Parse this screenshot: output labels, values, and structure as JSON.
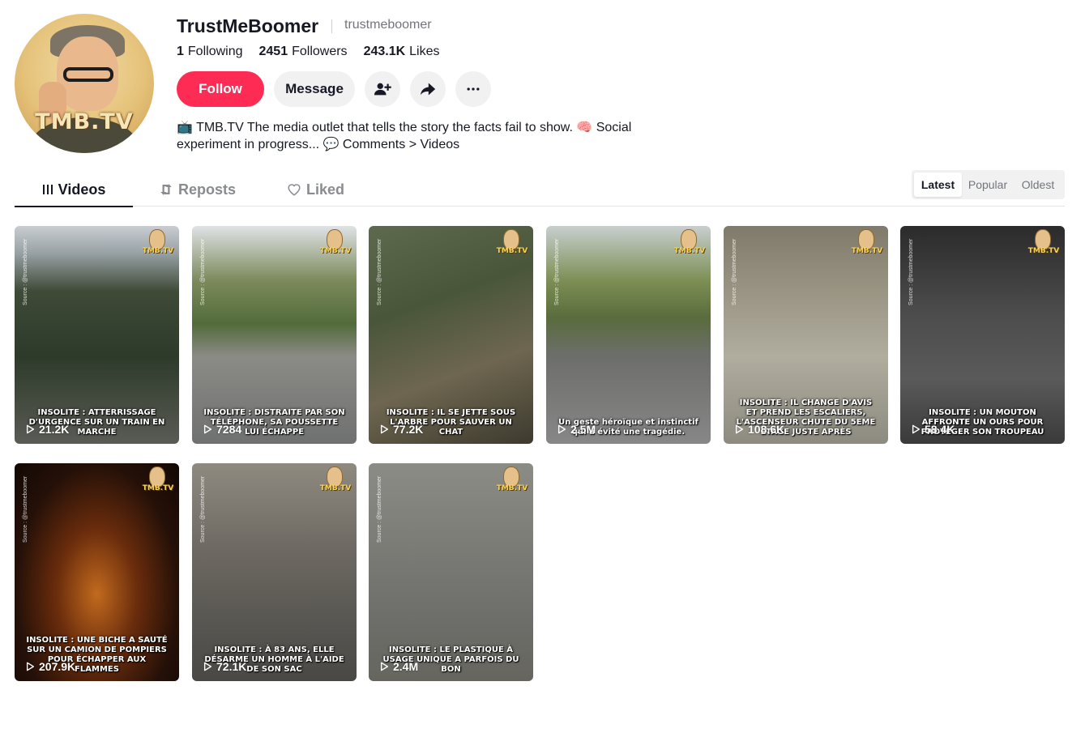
{
  "profile": {
    "display_name": "TrustMeBoomer",
    "username": "trustmeboomer",
    "avatar_text": "TMB.TV",
    "stats": [
      {
        "value": "1",
        "label": "Following"
      },
      {
        "value": "2451",
        "label": "Followers"
      },
      {
        "value": "243.1K",
        "label": "Likes"
      }
    ],
    "follow_label": "Follow",
    "message_label": "Message",
    "bio_line1": "📺 TMB.TV The media outlet that tells the story the facts fail to show. 🧠 Social",
    "bio_line2": "experiment in progress... 💬 Comments > Videos"
  },
  "tabs": {
    "videos": "Videos",
    "reposts": "Reposts",
    "liked": "Liked"
  },
  "sort": {
    "latest": "Latest",
    "popular": "Popular",
    "oldest": "Oldest"
  },
  "colors": {
    "follow": "#fe2c55",
    "text": "#161823",
    "muted": "#73757c"
  },
  "videos": [
    {
      "views": "21.2K",
      "caption": "INSOLITE : ATTERRISSAGE D'URGENCE SUR UN TRAIN EN MARCHE",
      "source": "Source : @trustmeboomer",
      "brand": "TMB.TV"
    },
    {
      "views": "7284",
      "caption": "INSOLITE : DISTRAITE PAR SON TÉLÉPHONE, SA POUSSETTE LUI ÉCHAPPE",
      "source": "Source : @trustmeboomer",
      "brand": "TMB.TV"
    },
    {
      "views": "77.2K",
      "caption": "INSOLITE : IL SE JETTE SOUS L'ARBRE POUR SAUVER UN CHAT",
      "source": "Source : @trustmeboomer",
      "brand": "TMB.TV"
    },
    {
      "views": "2.5M",
      "caption": "Un geste héroïque et instinctif qui a évité une tragédie.",
      "source": "Source : @trustmeboomer",
      "brand": "TMB.TV"
    },
    {
      "views": "108.6K",
      "caption": "INSOLITE : IL CHANGE D'AVIS ET PREND LES ESCALIERS, L'ASCENSEUR CHUTE DU 5EME ETAGE JUSTE APRÈS",
      "source": "Source : @trustmeboomer",
      "brand": "TMB.TV"
    },
    {
      "views": "58.4K",
      "caption": "INSOLITE : UN MOUTON AFFRONTE UN OURS POUR PROTÉGER SON TROUPEAU",
      "source": "Source : @trustmeboomer",
      "brand": "TMB.TV"
    },
    {
      "views": "207.9K",
      "caption": "INSOLITE : UNE BICHE A SAUTÉ SUR UN CAMION DE POMPIERS POUR ÉCHAPPER AUX FLAMMES",
      "source": "Source : @trustmeboomer",
      "brand": "TMB.TV"
    },
    {
      "views": "72.1K",
      "caption": "INSOLITE : À 83 ANS, ELLE DÉSARME UN HOMME À L'AIDE DE SON SAC",
      "source": "Source : @trustmeboomer",
      "brand": "TMB.TV"
    },
    {
      "views": "2.4M",
      "caption": "INSOLITE : LE PLASTIQUE À USAGE UNIQUE A PARFOIS DU BON",
      "source": "Source : @trustmeboomer",
      "brand": "TMB.TV"
    }
  ]
}
